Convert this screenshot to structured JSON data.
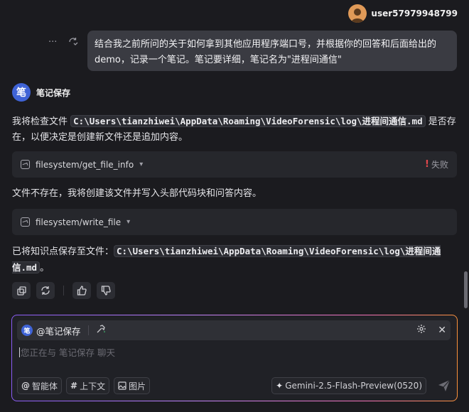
{
  "header": {
    "username": "user57979948799"
  },
  "user_message": {
    "text": "结合我之前所问的关于如何拿到其他应用程序端口号，并根据你的回答和后面给出的demo，记录一个笔记。笔记要详细，笔记名为\"进程间通信\""
  },
  "assistant": {
    "avatar_char": "笔",
    "name": "笔记保存",
    "para1_before": "我将检查文件 ",
    "para1_code": "C:\\Users\\tianzhiwei\\AppData\\Roaming\\VideoForensic\\log\\进程间通信.md",
    "para1_after": " 是否存在，以便决定是创建新文件还是追加内容。",
    "tool1": {
      "name": "filesystem/get_file_info",
      "status": "失败"
    },
    "para2": "文件不存在，我将创建该文件并写入头部代码块和问答内容。",
    "tool2": {
      "name": "filesystem/write_file"
    },
    "para3_before": "已将知识点保存至文件：",
    "para3_code": "C:\\Users\\tianzhiwei\\AppData\\Roaming\\VideoForensic\\log\\进程间通信.md",
    "para3_after": "。"
  },
  "composer": {
    "agent_label": "@笔记保存",
    "agent_avatar_char": "笔",
    "placeholder": "您正在与 笔记保存 聊天",
    "chips": {
      "agent": "智能体",
      "context": "上下文",
      "image": "图片"
    },
    "chip_symbols": {
      "agent": "@",
      "context": "#"
    },
    "model": "Gemini-2.5-Flash-Preview(0520)"
  },
  "colors": {
    "background": "#1b1b1f",
    "accent_blue": "#3f63d6",
    "error_red": "#e5484d",
    "gradient": [
      "#8b5cf6",
      "#c084fc",
      "#f472b6",
      "#fb923c"
    ]
  }
}
